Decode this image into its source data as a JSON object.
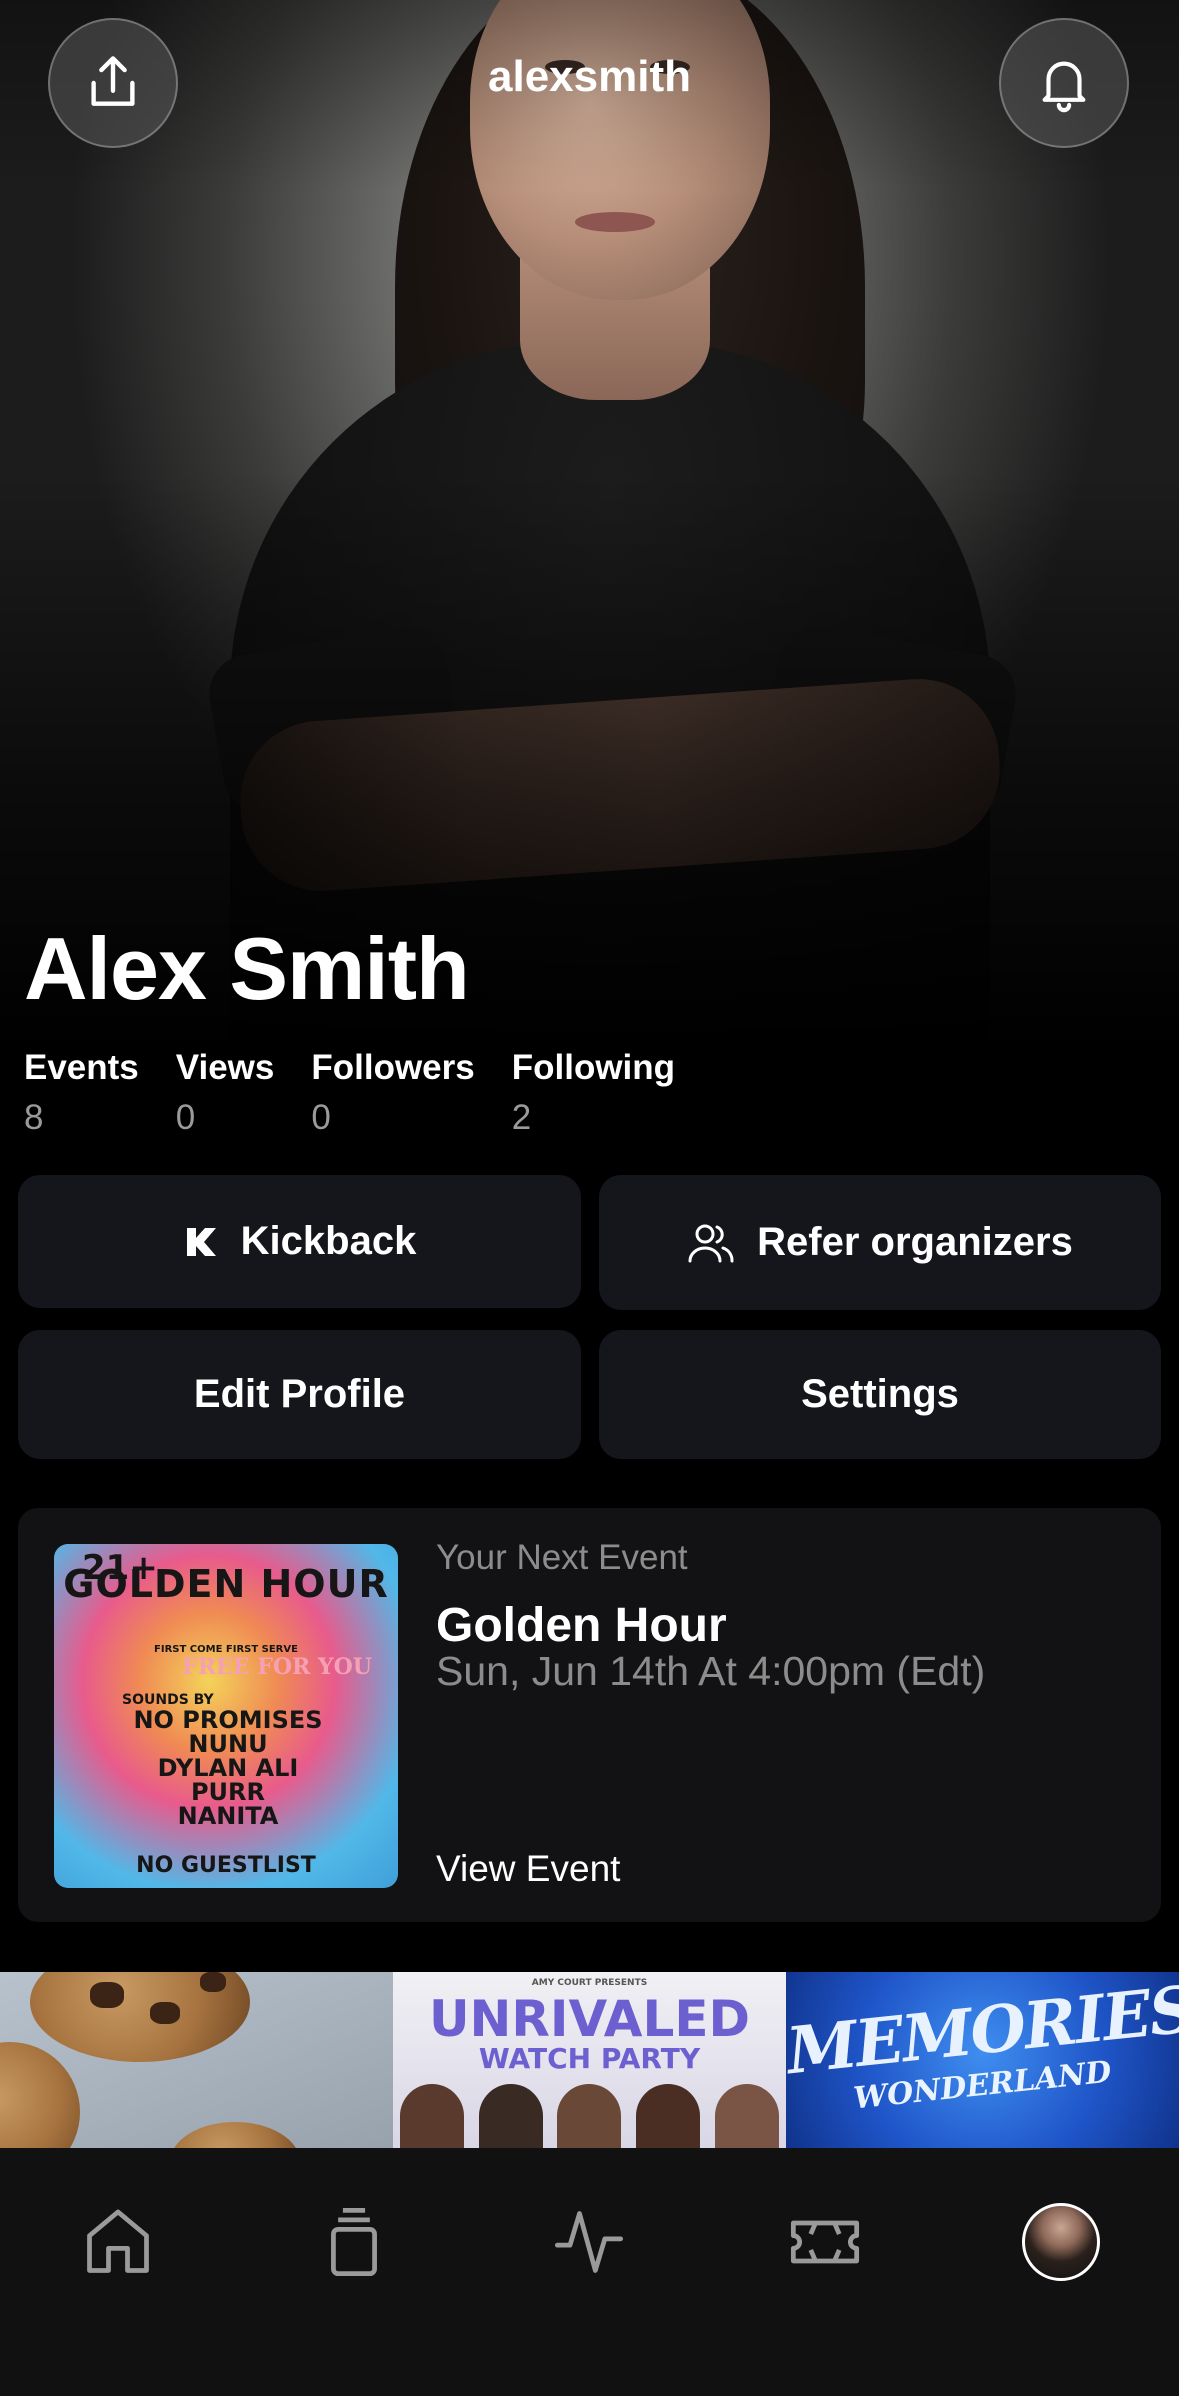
{
  "header": {
    "username": "alexsmith",
    "share_icon": "share-icon",
    "bell_icon": "bell-icon"
  },
  "profile": {
    "name": "Alex Smith",
    "stats": [
      {
        "label": "Events",
        "value": "8"
      },
      {
        "label": "Views",
        "value": "0"
      },
      {
        "label": "Followers",
        "value": "0"
      },
      {
        "label": "Following",
        "value": "2"
      }
    ]
  },
  "actions": {
    "kickback": "Kickback",
    "refer": "Refer organizers",
    "edit_profile": "Edit Profile",
    "settings": "Settings"
  },
  "next_event": {
    "kicker": "Your Next Event",
    "title": "Golden Hour",
    "date": "Sun, Jun 14th At 4:00pm (Edt)",
    "link": "View Event",
    "poster": {
      "age": "21+",
      "title": "GOLDEN HOUR",
      "subtitle": "FIRST COME FIRST SERVE",
      "tag": "FREE FOR YOU",
      "sounds_by": "SOUNDS BY",
      "lineup": [
        "NO PROMISES",
        "NUNU",
        "DYLAN ALI",
        "PURR",
        "NANITA"
      ],
      "footer": "NO GUESTLIST"
    }
  },
  "tiles": {
    "t2_kicker": "AMY COURT PRESENTS",
    "t2_title": "UNRIVALED",
    "t2_sub": "WATCH PARTY",
    "t3_title": "MEMORIES",
    "t3_sub": "WONDERLAND"
  },
  "tabbar": {
    "items": [
      "home-icon",
      "stack-icon",
      "activity-icon",
      "ticket-icon",
      "profile-avatar"
    ]
  },
  "colors": {
    "background": "#000000",
    "card": "#15161b",
    "muted_text": "#8c8c8c"
  }
}
